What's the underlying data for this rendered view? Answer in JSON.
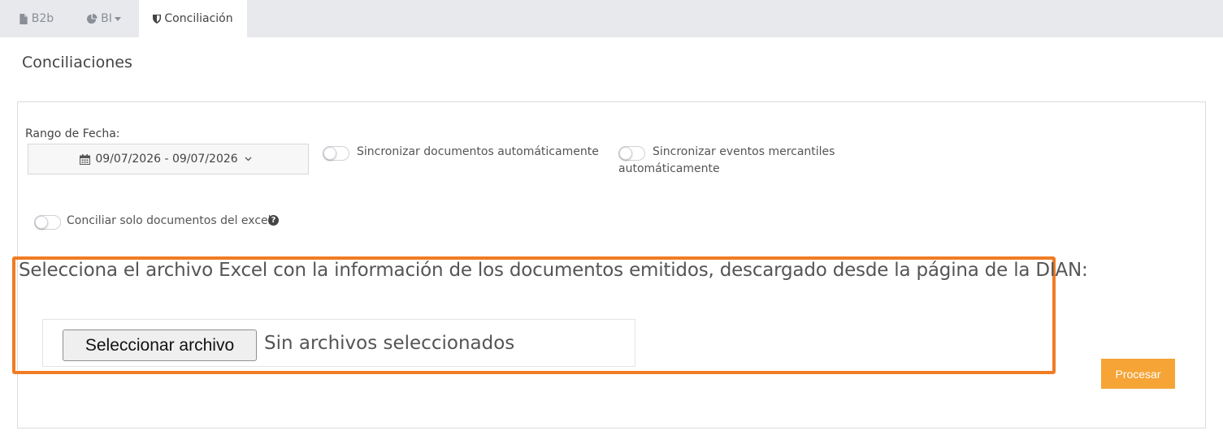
{
  "tabs": [
    {
      "label": "B2b",
      "icon": "file-icon"
    },
    {
      "label": "BI",
      "icon": "pie-chart-icon"
    },
    {
      "label": "Conciliación",
      "icon": "shield-icon"
    }
  ],
  "page": {
    "title": "Conciliaciones"
  },
  "form": {
    "date_label": "Rango de Fecha:",
    "date_value": "09/07/2026 - 09/07/2026",
    "sync_docs_label": "Sincronizar documentos automáticamente",
    "sync_events_label_line1": "Sincronizar eventos mercantiles",
    "sync_events_label_line2": "automáticamente",
    "excel_only_label": "Conciliar solo documentos del excel",
    "help_glyph": "?",
    "instruction": "Selecciona el archivo Excel con la información de los documentos emitidos, descargado desde la página de la DIAN:",
    "file_button": "Seleccionar archivo",
    "file_status": "Sin archivos seleccionados",
    "process_button": "Procesar"
  },
  "colors": {
    "accent": "#f5a435",
    "highlight": "#f07c23"
  }
}
